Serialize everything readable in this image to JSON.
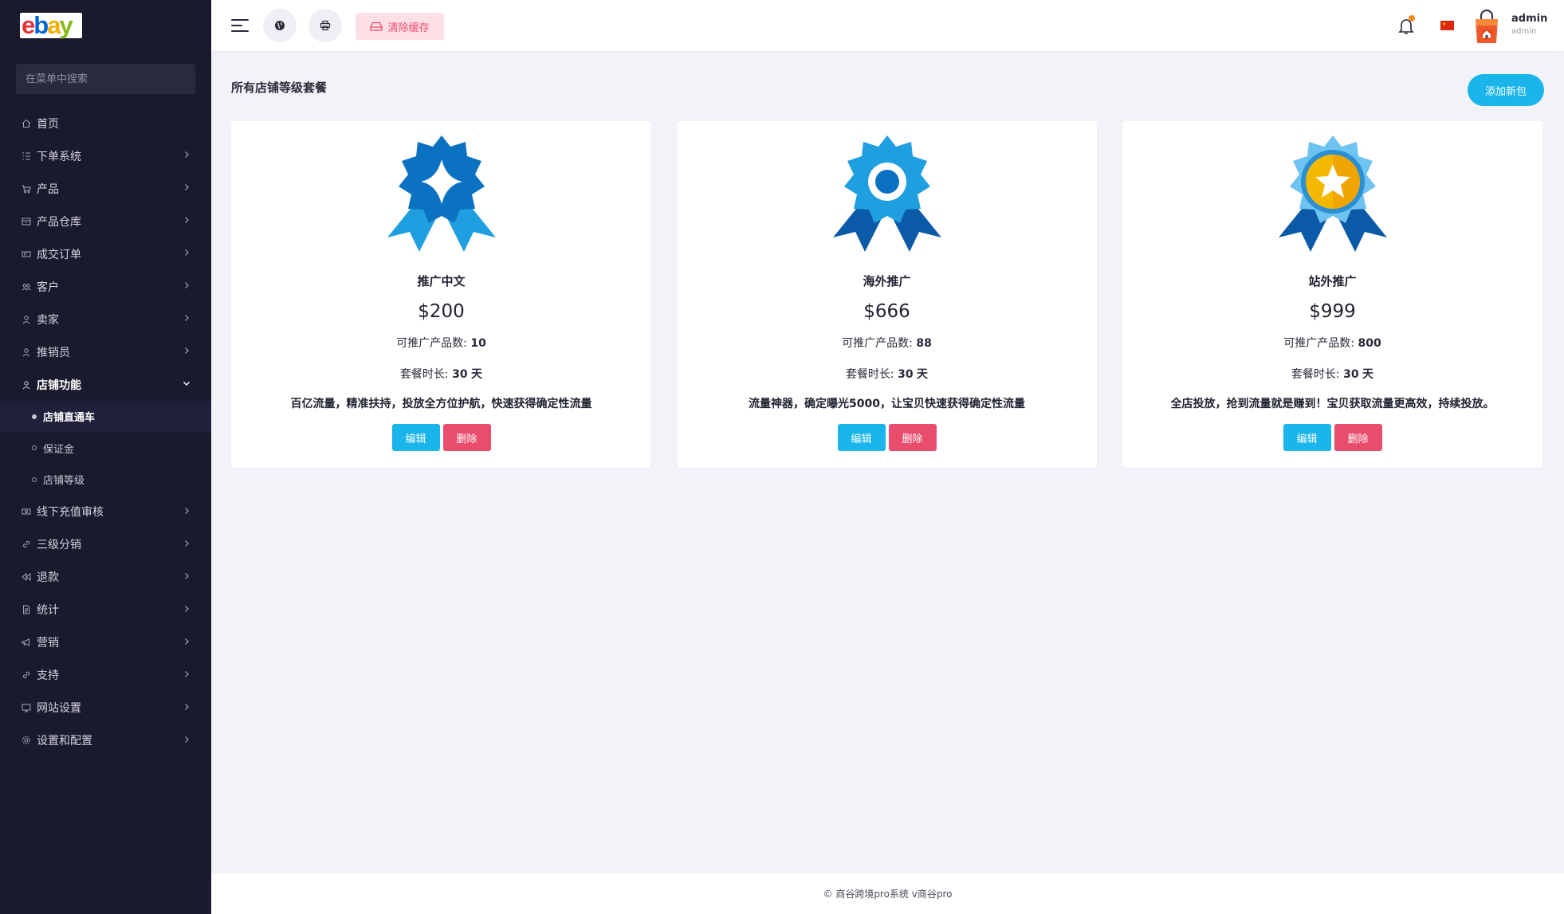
{
  "brand": {
    "logo_letters": [
      "e",
      "b",
      "a",
      "y"
    ],
    "logo_colors": [
      "#e53238",
      "#0064d2",
      "#f5af02",
      "#86b817"
    ]
  },
  "sidebar": {
    "search_placeholder": "在菜单中搜索",
    "items": [
      {
        "label": "首页",
        "icon": "home-icon",
        "chevron": false
      },
      {
        "label": "下单系统",
        "icon": "list-icon",
        "chevron": true
      },
      {
        "label": "产品",
        "icon": "cart-icon",
        "chevron": true
      },
      {
        "label": "产品仓库",
        "icon": "warehouse-icon",
        "chevron": true
      },
      {
        "label": "成交订单",
        "icon": "ticket-icon",
        "chevron": true
      },
      {
        "label": "客户",
        "icon": "users-icon",
        "chevron": true
      },
      {
        "label": "卖家",
        "icon": "user-icon",
        "chevron": true
      },
      {
        "label": "推销员",
        "icon": "user-icon",
        "chevron": true
      },
      {
        "label": "店铺功能",
        "icon": "user-icon",
        "chevron": true,
        "expanded": true,
        "children": [
          {
            "label": "店铺直通车",
            "active": true
          },
          {
            "label": "保证金",
            "active": false
          },
          {
            "label": "店铺等级",
            "active": false
          }
        ]
      },
      {
        "label": "线下充值审核",
        "icon": "money-icon",
        "chevron": true
      },
      {
        "label": "三级分销",
        "icon": "link-icon",
        "chevron": true
      },
      {
        "label": "退款",
        "icon": "refund-icon",
        "chevron": true
      },
      {
        "label": "统计",
        "icon": "document-icon",
        "chevron": true
      },
      {
        "label": "营销",
        "icon": "megaphone-icon",
        "chevron": true
      },
      {
        "label": "支持",
        "icon": "link-icon",
        "chevron": true
      },
      {
        "label": "网站设置",
        "icon": "monitor-icon",
        "chevron": true
      },
      {
        "label": "设置和配置",
        "icon": "settings-icon",
        "chevron": true
      }
    ]
  },
  "topbar": {
    "clear_cache_label": "清除缓存",
    "user_name": "admin",
    "user_role": "admin",
    "flag_star": "★"
  },
  "main": {
    "page_title": "所有店铺等级套餐",
    "add_button_label": "添加新包",
    "count_label": "可推广产品数:",
    "duration_label": "套餐时长:",
    "duration_unit": "天",
    "edit_label": "编辑",
    "delete_label": "删除",
    "packages": [
      {
        "name": "推广中文",
        "price": "$200",
        "product_count": "10",
        "duration": "30",
        "description": "百亿流量，精准扶持，投放全方位护航，快速获得确定性流量",
        "badge": "diamond-badge-icon"
      },
      {
        "name": "海外推广",
        "price": "$666",
        "product_count": "88",
        "duration": "30",
        "description": "流量神器，确定曝光5000，让宝贝快速获得确定性流量",
        "badge": "ring-badge-icon"
      },
      {
        "name": "站外推广",
        "price": "$999",
        "product_count": "800",
        "duration": "30",
        "description": "全店投放，抢到流量就是赚到！宝贝获取流量更高效，持续投放。",
        "badge": "star-badge-icon"
      }
    ]
  },
  "footer": {
    "text": "© 商谷跨境pro系统 v商谷pro"
  },
  "colors": {
    "sidebar_bg": "#1a1a2e",
    "accent": "#1ab5ea",
    "danger": "#e94c6d"
  }
}
